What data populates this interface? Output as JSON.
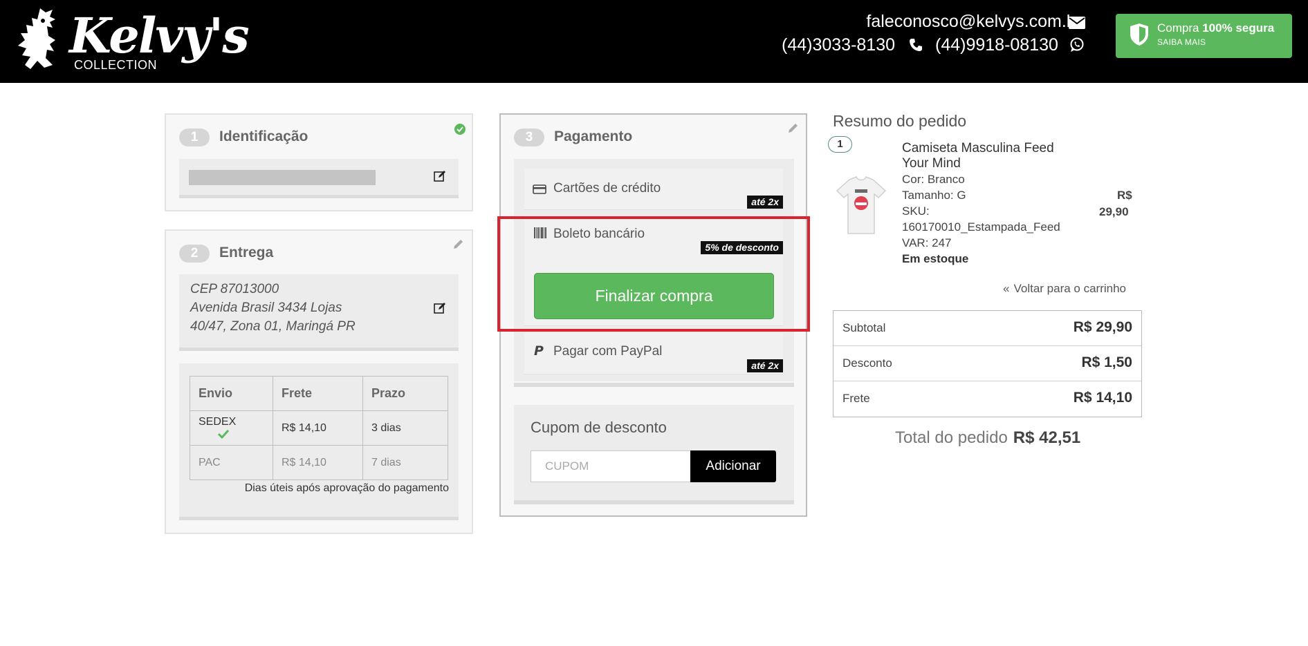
{
  "header": {
    "logo_text": "Kelvy's",
    "logo_sub": "COLLECTION",
    "email": "faleconosco@kelvys.com.br",
    "phone": "(44)3033-8130",
    "whatsapp": "(44)9918-08130",
    "secure": {
      "prefix": "Compra",
      "bold": "100% segura",
      "sub": "SAIBA MAIS"
    },
    "accent": "#5cb85c"
  },
  "identificacao": {
    "step": "1",
    "title": "Identificação"
  },
  "entrega": {
    "step": "2",
    "title": "Entrega",
    "address": [
      "CEP 87013000",
      "Avenida Brasil 3434 Lojas",
      "40/47, Zona 01, Maringá PR"
    ],
    "table": {
      "headers": [
        "Envio",
        "Frete",
        "Prazo"
      ],
      "rows": [
        {
          "envio": "SEDEX",
          "frete": "R$ 14,10",
          "prazo": "3 dias",
          "selected": true
        },
        {
          "envio": "PAC",
          "frete": "R$ 14,10",
          "prazo": "7 dias",
          "selected": false
        }
      ]
    },
    "note": "Dias úteis após aprovação do pagamento"
  },
  "pagamento": {
    "step": "3",
    "title": "Pagamento",
    "options": [
      {
        "label": "Cartões de crédito",
        "badge": "até 2x"
      },
      {
        "label": "Boleto bancário",
        "badge": "5% de desconto"
      },
      {
        "label": "Pagar com PayPal",
        "badge": "até 2x"
      }
    ],
    "finish_button": "Finalizar compra",
    "coupon": {
      "title": "Cupom de desconto",
      "placeholder": "CUPOM",
      "button": "Adicionar"
    }
  },
  "resumo": {
    "title": "Resumo do pedido",
    "item": {
      "qty": "1",
      "name": "Camiseta Masculina Feed Your Mind",
      "cor": "Cor: Branco",
      "tamanho": "Tamanho: G",
      "sku_label": "SKU:",
      "sku": "160170010_Estampada_Feed",
      "var": "VAR: 247",
      "stock": "Em estoque",
      "price_currency": "R$",
      "price_value": "29,90"
    },
    "back_link": "Voltar para o carrinho",
    "totals": [
      {
        "label": "Subtotal",
        "value": "R$ 29,90"
      },
      {
        "label": "Desconto",
        "value": "R$ 1,50"
      },
      {
        "label": "Frete",
        "value": "R$ 14,10"
      }
    ],
    "grand_total_label": "Total do pedido",
    "grand_total_value": "R$ 42,51"
  }
}
